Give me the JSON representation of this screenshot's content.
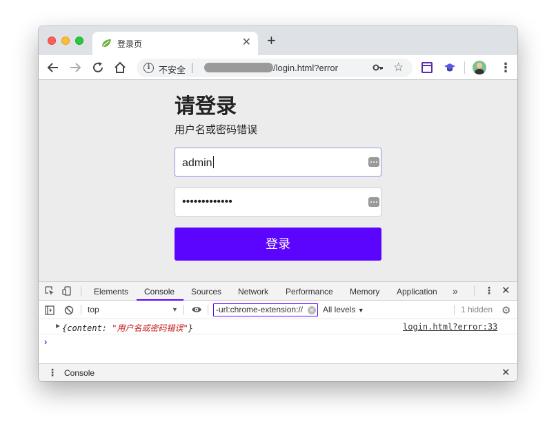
{
  "browser": {
    "tab_title": "登录页",
    "omnibox": {
      "security_label": "不安全",
      "url_visible": "/login.html?error"
    }
  },
  "login": {
    "title": "请登录",
    "error_message": "用户名或密码错误",
    "username_value": "admin",
    "password_value": "•••••••••••••",
    "submit_label": "登录"
  },
  "devtools": {
    "tabs": [
      "Elements",
      "Console",
      "Sources",
      "Network",
      "Performance",
      "Memory",
      "Application"
    ],
    "active_tab": "Console",
    "more_tabs": "»",
    "console": {
      "context": "top",
      "filter_text": "-url:chrome-extension://",
      "levels_label": "All levels",
      "hidden_label": "1 hidden",
      "log": {
        "prefix": "{content: ",
        "string_value": "\"用户名或密码错误\"",
        "suffix": "}",
        "source": "login.html?error:33"
      },
      "prompt_symbol": "›"
    },
    "drawer_tab": "Console"
  },
  "colors": {
    "accent": "#5b05ff",
    "string_red": "#c41a16",
    "page_bg": "#ececec"
  }
}
